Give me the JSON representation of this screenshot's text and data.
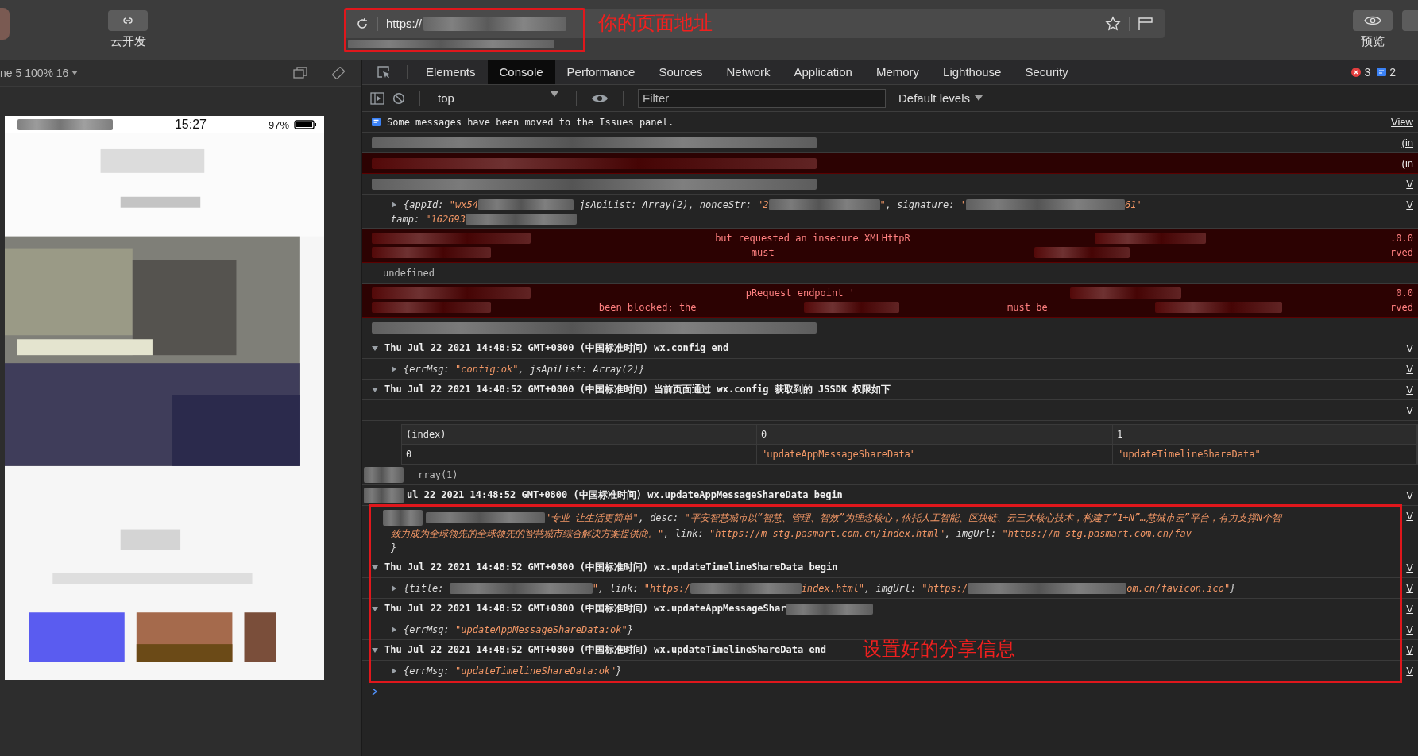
{
  "topbar": {
    "cloud_button": {
      "label": "云开发"
    },
    "url": {
      "value": "https://",
      "note": "你的页面地址"
    },
    "preview_button": {
      "label": "预览"
    }
  },
  "simulator": {
    "device_label": "ne 5 100% 16",
    "status_time": "15:27",
    "battery": "97%"
  },
  "devtools": {
    "tabs": [
      {
        "label": "Elements",
        "selected": false
      },
      {
        "label": "Console",
        "selected": true
      },
      {
        "label": "Performance",
        "selected": false
      },
      {
        "label": "Sources",
        "selected": false
      },
      {
        "label": "Network",
        "selected": false
      },
      {
        "label": "Application",
        "selected": false
      },
      {
        "label": "Memory",
        "selected": false
      },
      {
        "label": "Lighthouse",
        "selected": false
      },
      {
        "label": "Security",
        "selected": false
      }
    ],
    "error_count": "3",
    "info_count": "2",
    "toolbar": {
      "context": "top",
      "filter_placeholder": "Filter",
      "levels": "Default levels"
    }
  },
  "console": {
    "rows": [
      {
        "kind": "issues",
        "text": "Some messages have been moved to the Issues panel.",
        "source": "View"
      },
      {
        "kind": "redacted",
        "source": "(in"
      },
      {
        "kind": "redacted_error",
        "source": "(in"
      },
      {
        "kind": "redacted",
        "source": "V"
      },
      {
        "kind": "object",
        "expanded": false,
        "source": "V",
        "lines": [
          [
            {
              "kind": "key",
              "text": "{appId: "
            },
            {
              "kind": "string",
              "text": "\"wx54"
            },
            {
              "kind": "redact"
            },
            {
              "kind": "key",
              "text": " jsApiList: Array(2), nonceStr: "
            },
            {
              "kind": "string",
              "text": "\"2"
            },
            {
              "kind": "redact"
            },
            {
              "kind": "string",
              "text": "\""
            },
            {
              "kind": "key",
              "text": ", signature: "
            },
            {
              "kind": "string",
              "text": "'"
            },
            {
              "kind": "redact"
            },
            {
              "kind": "string",
              "text": "61'"
            }
          ],
          [
            {
              "kind": "key",
              "text": "tamp: "
            },
            {
              "kind": "string",
              "text": "\"162693"
            },
            {
              "kind": "redact"
            }
          ]
        ]
      },
      {
        "kind": "error",
        "lines": [
          [
            {
              "kind": "redact"
            },
            {
              "kind": "error",
              "text": "but requested an insecure XMLHttpR"
            },
            {
              "kind": "redact"
            },
            {
              "kind": "error",
              "text": ".0.0"
            }
          ],
          [
            {
              "kind": "redact"
            },
            {
              "kind": "error",
              "text": "must"
            },
            {
              "kind": "redact"
            },
            {
              "kind": "error",
              "text": "rved"
            }
          ]
        ]
      },
      {
        "kind": "text",
        "text": "undefined"
      },
      {
        "kind": "error",
        "lines": [
          [
            {
              "kind": "redact"
            },
            {
              "kind": "error",
              "text": "pRequest endpoint '"
            },
            {
              "kind": "redact"
            },
            {
              "kind": "error",
              "text": "0.0"
            }
          ],
          [
            {
              "kind": "redact"
            },
            {
              "kind": "error",
              "text": "been blocked; the"
            },
            {
              "kind": "redact"
            },
            {
              "kind": "error",
              "text": "must be"
            },
            {
              "kind": "redact"
            },
            {
              "kind": "error",
              "text": "rved"
            }
          ]
        ]
      },
      {
        "kind": "redacted"
      },
      {
        "kind": "group",
        "expanded": true,
        "text": "Thu Jul 22 2021 14:48:52 GMT+0800 (中国标准时间) wx.config end",
        "source": "V"
      },
      {
        "kind": "object",
        "expanded": false,
        "source": "V",
        "lines": [
          [
            {
              "kind": "key",
              "text": "{errMsg: "
            },
            {
              "kind": "string",
              "text": "\"config:ok\""
            },
            {
              "kind": "key",
              "text": ", jsApiList: Array(2)}"
            }
          ]
        ]
      },
      {
        "kind": "group",
        "expanded": true,
        "text": "Thu Jul 22 2021 14:48:52 GMT+0800 (中国标准时间) 当前页面通过 wx.config 获取到的 JSSDK 权限如下",
        "source": "V"
      },
      {
        "kind": "blank",
        "source": "V"
      },
      {
        "kind": "table",
        "columns": [
          "(index)",
          "0",
          "1"
        ],
        "rows": [
          [
            "0",
            "\"updateAppMessageShareData\"",
            "\"updateTimelineShareData\""
          ]
        ]
      },
      {
        "kind": "text",
        "text": "rray(1)",
        "covered": true
      },
      {
        "kind": "group",
        "covered": true,
        "text": "ul 22 2021 14:48:52 GMT+0800 (中国标准时间) wx.updateAppMessageShareData begin",
        "source": "V"
      }
    ],
    "highlight": {
      "note": "设置好的分享信息",
      "rows": [
        {
          "kind": "object",
          "covered": true,
          "source": "V",
          "lines": [
            [
              {
                "kind": "redact"
              },
              {
                "kind": "string",
                "text": "\"专业 让生活更简单\""
              },
              {
                "kind": "key",
                "text": ", desc: "
              },
              {
                "kind": "string",
                "text": "\"平安智慧城市以“智慧、管理、智效”为理念核心，依托人工智能、区块链、云三大核心技术，构建了“1+N”…慧城市云”平台，有力支撑N个智"
              }
            ],
            [
              {
                "kind": "string",
                "text": "致力成为全球领先的全球领先的智慧城市综合解决方案提供商。\""
              },
              {
                "kind": "key",
                "text": ", link: "
              },
              {
                "kind": "string",
                "text": "\"https://m-stg.pasmart.com.cn/index.html\""
              },
              {
                "kind": "key",
                "text": ", imgUrl: "
              },
              {
                "kind": "string",
                "text": "\"https://m-stg.pasmart.com.cn/fav"
              }
            ],
            [
              {
                "kind": "key",
                "text": "}"
              }
            ]
          ]
        },
        {
          "kind": "group",
          "expanded": true,
          "text": "Thu Jul 22 2021 14:48:52 GMT+0800 (中国标准时间) wx.updateTimelineShareData begin",
          "source": "V"
        },
        {
          "kind": "object",
          "expanded": false,
          "source": "V",
          "lines": [
            [
              {
                "kind": "key",
                "text": "{title: "
              },
              {
                "kind": "redact"
              },
              {
                "kind": "string",
                "text": "\""
              },
              {
                "kind": "key",
                "text": ", link: "
              },
              {
                "kind": "string",
                "text": "\"https:/"
              },
              {
                "kind": "redact"
              },
              {
                "kind": "string",
                "text": "index.html\""
              },
              {
                "kind": "key",
                "text": ", imgUrl: "
              },
              {
                "kind": "string",
                "text": "\"https:/"
              },
              {
                "kind": "redact"
              },
              {
                "kind": "string",
                "text": "om.cn/favicon.ico\""
              },
              {
                "kind": "key",
                "text": "}"
              }
            ]
          ]
        },
        {
          "kind": "group",
          "expanded": true,
          "trail_redacted": true,
          "text": "Thu Jul 22 2021 14:48:52 GMT+0800 (中国标准时间) wx.updateAppMessageShar",
          "source": "V"
        },
        {
          "kind": "object",
          "expanded": false,
          "source": "V",
          "lines": [
            [
              {
                "kind": "key",
                "text": "{errMsg: "
              },
              {
                "kind": "string",
                "text": "\"updateAppMessageShareData:ok\""
              },
              {
                "kind": "key",
                "text": "}"
              }
            ]
          ]
        },
        {
          "kind": "group",
          "expanded": true,
          "text": "Thu Jul 22 2021 14:48:52 GMT+0800 (中国标准时间) wx.updateTimelineShareData end",
          "source": "V"
        },
        {
          "kind": "object",
          "expanded": false,
          "source": "V",
          "lines": [
            [
              {
                "kind": "key",
                "text": "{errMsg: "
              },
              {
                "kind": "string",
                "text": "\"updateTimelineShareData:ok\""
              },
              {
                "kind": "key",
                "text": "}"
              }
            ]
          ]
        }
      ]
    }
  }
}
